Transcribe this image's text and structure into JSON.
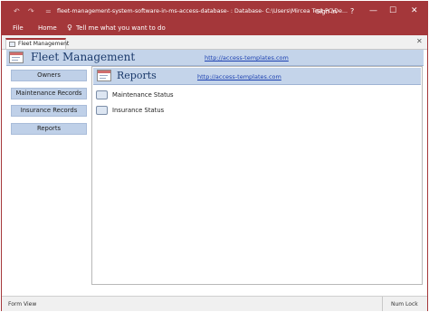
{
  "window": {
    "title": "fleet-management-system-software-in-ms-access-database- : Database- C:\\Users\\Mircea Test PC\\De...",
    "sign_in": "Sign in",
    "help_glyph": "?",
    "min_glyph": "—",
    "restore_glyph": "☐",
    "close_glyph": "✕",
    "undo_glyph": "↶",
    "redo_glyph": "↷",
    "qat_glyph": "="
  },
  "ribbon": {
    "file": "File",
    "home": "Home",
    "tell_me": "Tell me what you want to do",
    "tell_me_icon": "lightbulb-icon"
  },
  "document_tab": {
    "label": "Fleet Management",
    "close_glyph": "✕"
  },
  "form": {
    "title": "Fleet Management",
    "link": "http://access-templates.com"
  },
  "sidebar": {
    "items": [
      {
        "label": "Owners"
      },
      {
        "label": "Maintenance Records"
      },
      {
        "label": "Insurance Records"
      },
      {
        "label": "Reports"
      }
    ]
  },
  "subform": {
    "title": "Reports",
    "link": "http://access-templates.com",
    "reports": [
      {
        "label": "Maintenance Status"
      },
      {
        "label": "Insurance Status"
      }
    ]
  },
  "statusbar": {
    "left": "Form View",
    "right": "Num Lock"
  },
  "colors": {
    "accent": "#a4373a",
    "header_band": "#c4d4ea",
    "sidebar_button": "#bfd0e8",
    "link": "#1a3fb0"
  }
}
